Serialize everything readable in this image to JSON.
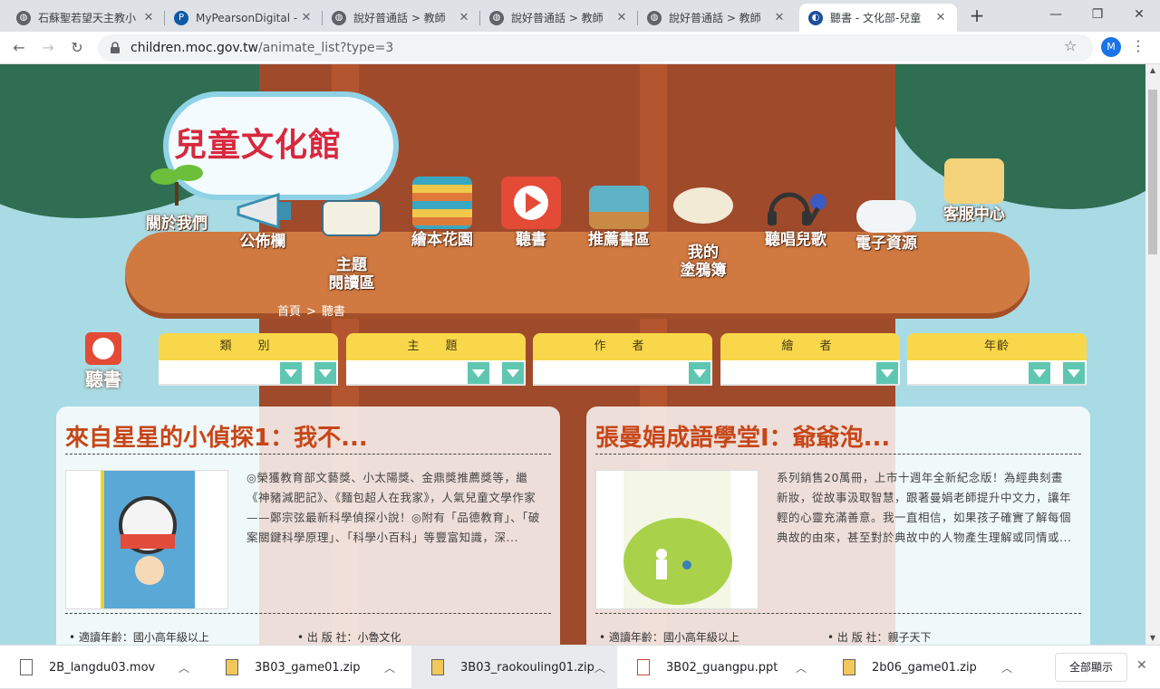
{
  "browser": {
    "tabs": [
      {
        "title": "石蘇聖若望天主教小",
        "favicon": "globe-icon"
      },
      {
        "title": "MyPearsonDigital - ",
        "favicon": "pearson-icon"
      },
      {
        "title": "說好普通話 > 教師",
        "favicon": "globe-icon"
      },
      {
        "title": "說好普通話 > 教師",
        "favicon": "globe-icon"
      },
      {
        "title": "說好普通話 > 教師",
        "favicon": "globe-icon"
      },
      {
        "title": "聽書 - 文化部-兒童",
        "favicon": "moc-icon",
        "active": true
      }
    ],
    "url_host": "children.moc.gov.tw",
    "url_path": "/animate_list?type=3",
    "profile_initial": "M"
  },
  "site": {
    "logo_text": "兒童文化館",
    "nav": [
      {
        "label": "關於我們"
      },
      {
        "label": "公佈欄"
      },
      {
        "label": "主題\n閱讀區"
      },
      {
        "label": "繪本花園"
      },
      {
        "label": "聽書"
      },
      {
        "label": "推薦書區"
      },
      {
        "label": "我的\n塗鴉簿"
      },
      {
        "label": "聽唱兒歌"
      },
      {
        "label": "電子資源"
      },
      {
        "label": "客服中心"
      }
    ],
    "breadcrumb": {
      "home": "首頁",
      "sep": ">",
      "current": "聽書"
    },
    "section_label": "聽書",
    "filters": [
      {
        "label": "類　別"
      },
      {
        "label": "主　題"
      },
      {
        "label": "作　者"
      },
      {
        "label": "繪　者"
      },
      {
        "label": "年齡"
      }
    ],
    "books": [
      {
        "title": "來自星星的小偵探1：我不...",
        "description": "◎榮獲教育部文藝獎、小太陽獎、金鼎獎推薦獎等，繼《神豬減肥記》、《麵包超人在我家》，人氣兒童文學作家——鄭宗弦最新科學偵探小說！◎附有「品德教育」、「破案關鍵科學原理」、「科學小百科」等豐富知識，深...",
        "age": "適讀年齡：國小高年級以上",
        "publisher": "出 版 社：小魯文化"
      },
      {
        "title": "張曼娟成語學堂Ⅰ：爺爺泡...",
        "description": "系列銷售20萬冊，上市十週年全新紀念版！為經典刻畫新妝，從故事汲取智慧，跟著曼娟老師提升中文力，讓年輕的心靈充滿善意。我一直相信，如果孩子確實了解每個典故的由來，甚至對於典故中的人物產生理解或同情或...",
        "age": "適讀年齡：國小高年級以上",
        "publisher": "出 版 社：親子天下"
      }
    ]
  },
  "downloads": {
    "items": [
      {
        "name": "2B_langdu03.mov",
        "type": "file-icon"
      },
      {
        "name": "3B03_game01.zip",
        "type": "zip-icon"
      },
      {
        "name": "3B03_raokouling01.zip",
        "type": "zip-icon",
        "selected": true
      },
      {
        "name": "3B02_guangpu.ppt",
        "type": "ppt-icon"
      },
      {
        "name": "2b06_game01.zip",
        "type": "zip-icon"
      }
    ],
    "show_all": "全部顯示"
  },
  "colors": {
    "sky": "#a9dbe4",
    "trunk": "#a04a2c",
    "platform": "#d07a42",
    "filter_head": "#f8d84a",
    "dropdown": "#5fc7b1",
    "title": "#c74618"
  }
}
